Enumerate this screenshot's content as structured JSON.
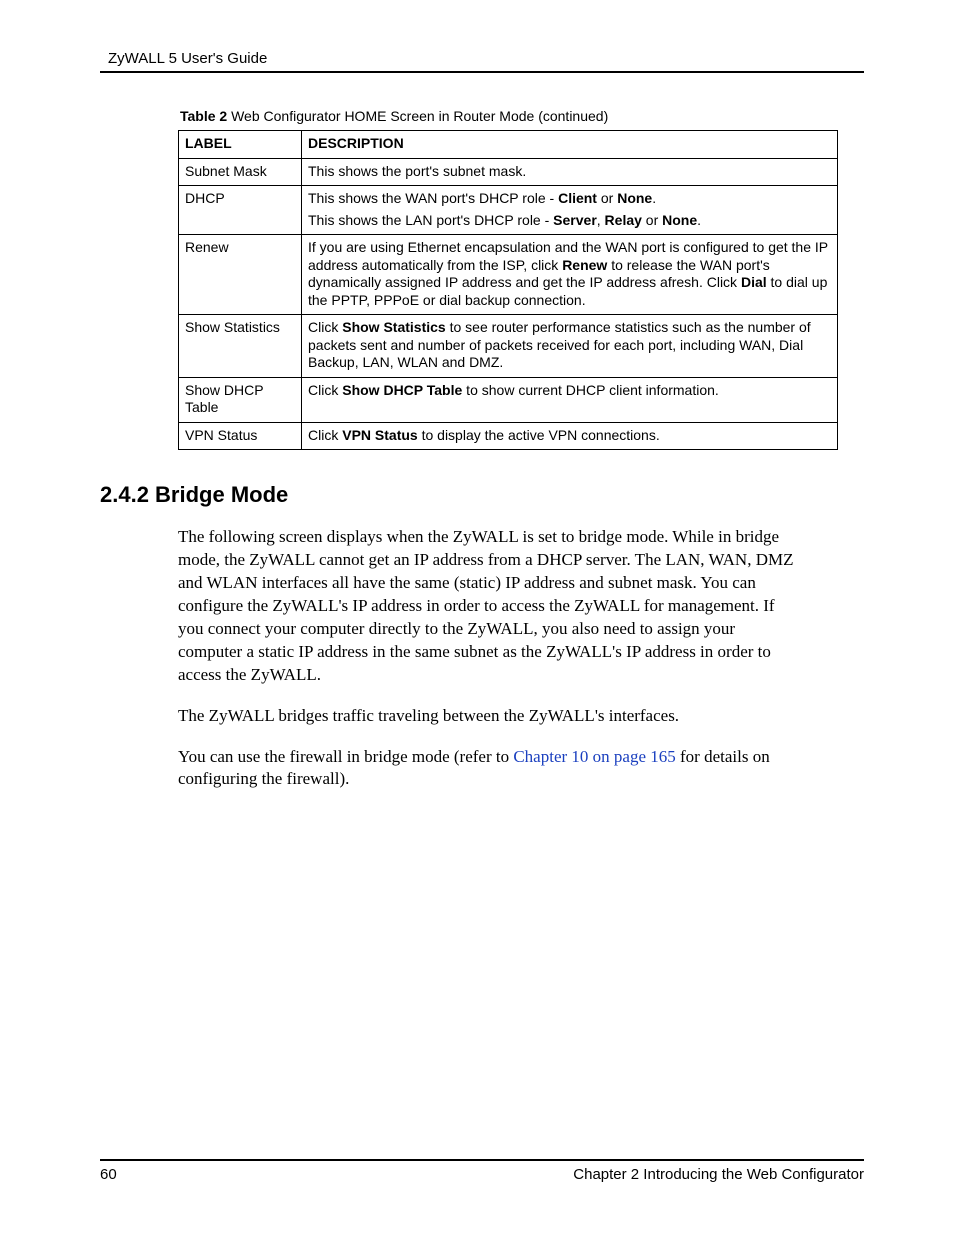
{
  "header": {
    "guide_title": "ZyWALL 5 User's Guide"
  },
  "table": {
    "caption_label": "Table 2",
    "caption_rest": "   Web Configurator HOME Screen in Router Mode (continued)",
    "headers": {
      "label": "LABEL",
      "description": "DESCRIPTION"
    },
    "rows": {
      "subnet_mask": {
        "label": "Subnet Mask",
        "desc": "This shows the port's subnet mask."
      },
      "dhcp": {
        "label": "DHCP",
        "line1_a": "This shows the WAN port's DHCP role - ",
        "line1_b1": "Client",
        "line1_mid": " or ",
        "line1_b2": "None",
        "line1_end": ".",
        "line2_a": "This shows the LAN port's DHCP role - ",
        "line2_b1": "Server",
        "line2_sep1": ", ",
        "line2_b2": "Relay",
        "line2_sep2": " or ",
        "line2_b3": "None",
        "line2_end": "."
      },
      "renew": {
        "label": "Renew",
        "d1": "If you are using Ethernet encapsulation and the WAN port is configured to get the IP address automatically from the ISP, click ",
        "d1b": "Renew",
        "d2": " to release the WAN port's dynamically assigned IP address and get the IP address afresh. Click ",
        "d2b": "Dial",
        "d3": " to dial up the PPTP, PPPoE or dial backup connection."
      },
      "show_stats": {
        "label": "Show Statistics",
        "d1": "Click ",
        "d1b": "Show Statistics",
        "d2": " to see router performance statistics such as the number of packets sent and number of packets received for each port, including WAN, Dial Backup, LAN, WLAN and DMZ."
      },
      "show_dhcp": {
        "label": "Show DHCP Table",
        "d1": "Click ",
        "d1b": "Show DHCP Table",
        "d2": " to show current DHCP client information."
      },
      "vpn_status": {
        "label": "VPN Status",
        "d1": "Click ",
        "d1b": "VPN Status",
        "d2": " to display the active VPN connections."
      }
    }
  },
  "section": {
    "heading": "2.4.2  Bridge Mode",
    "p1": "The following screen displays when the ZyWALL is set to bridge mode. While in bridge mode, the ZyWALL cannot get an IP address from a DHCP server. The LAN, WAN, DMZ and WLAN interfaces all have the same (static) IP address and subnet mask. You can configure the ZyWALL's IP address in order to access the ZyWALL for management. If you connect your computer directly to the ZyWALL, you also need to assign your computer a static IP address in the same subnet as the ZyWALL's IP address in order to access the ZyWALL.",
    "p2": "The ZyWALL bridges traffic traveling between the ZyWALL's interfaces.",
    "p3a": "You can use the firewall in bridge mode (refer to ",
    "p3link": "Chapter 10 on page 165",
    "p3b": " for details on configuring the firewall)."
  },
  "footer": {
    "page_number": "60",
    "chapter": "Chapter 2 Introducing the Web Configurator"
  }
}
